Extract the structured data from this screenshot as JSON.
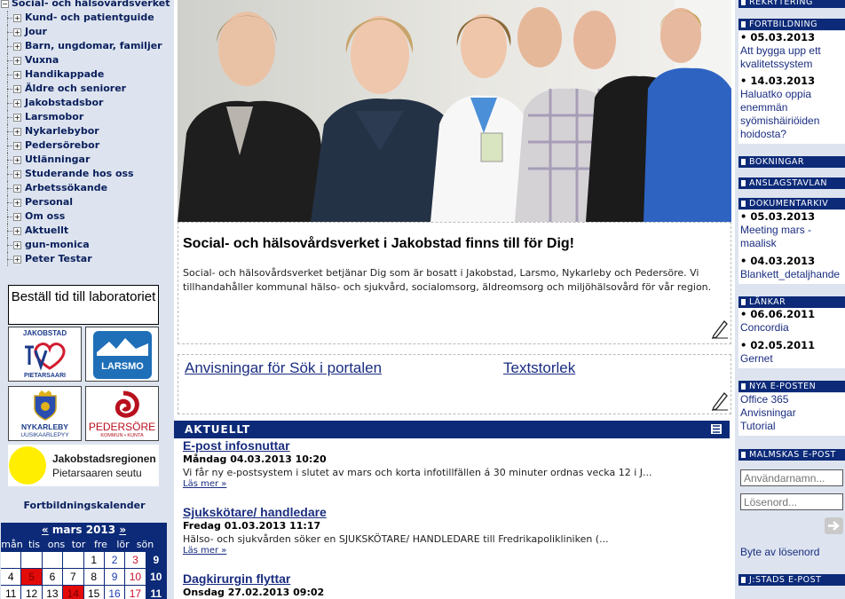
{
  "nav_tree": {
    "root": "Social- och hälsovårdsverket",
    "items": [
      "Kund- och patientguide",
      "Jour",
      "Barn, ungdomar, familjer",
      "Vuxna",
      "Handikappade",
      "Äldre och seniorer",
      "Jakobstadsbor",
      "Larsmobor",
      "Nykarlebybor",
      "Pedersörebor",
      "Utlänningar",
      "Studerande hos oss",
      "Arbetssökande",
      "Personal",
      "Om oss",
      "Aktuellt",
      "gun-monica",
      "Peter Testar"
    ]
  },
  "order_lab": "Beställ tid till laboratoriet",
  "logos": {
    "jakobstad": {
      "top": "JAKOBSTAD",
      "bottom": "PIETARSAARI"
    },
    "larsmo": "LARSMO",
    "nykarleby": {
      "top": "NYKARLEBY",
      "bottom": "UUSIKAARLEPYY"
    },
    "pedersore": {
      "top": "PEDERSÖRE",
      "bottom": "KOMMUN • KUNTA"
    },
    "region": {
      "line1": "Jakobstadsregionen",
      "line2": "Pietarsaaren seutu"
    }
  },
  "fortbildningskalender": "Fortbildningskalender",
  "calendar": {
    "prev": "«",
    "month": "mars 2013",
    "next": "»",
    "dow": [
      "mån",
      "tis",
      "ons",
      "tor",
      "fre",
      "lör",
      "sön"
    ],
    "rows": [
      [
        "",
        "",
        "",
        "",
        "1",
        "2",
        "3",
        "9"
      ],
      [
        "4",
        "5",
        "6",
        "7",
        "8",
        "9",
        "10",
        "10"
      ],
      [
        "11",
        "12",
        "13",
        "14",
        "15",
        "16",
        "17",
        "11"
      ]
    ]
  },
  "intro": {
    "title": "Social- och hälsovårdsverket i Jakobstad finns till för Dig!",
    "text": "Social- och hälsovårdsverket betjänar Dig som är bosatt i Jakobstad, Larsmo, Nykarleby och Pedersöre. Vi tillhandahåller kommunal hälso- och sjukvård, socialomsorg, äldreomsorg och miljöhälsovård för vår region."
  },
  "links": {
    "search_help": "Anvisningar för Sök i portalen",
    "text_size": "Textstorlek"
  },
  "news": {
    "header": "AKTUELLT",
    "items": [
      {
        "title": "E-post infosnuttar",
        "date": "Måndag 04.03.2013 10:20",
        "text": "Vi får ny e-postsystem i slutet av mars och korta infotillfällen á 30 minuter ordnas vecka 12 i J...",
        "more": "Läs mer »"
      },
      {
        "title": "Sjukskötare/ handledare",
        "date": "Fredag 01.03.2013 11:17",
        "text": "  Hälso- och sjukvården söker en SJUKSKÖTARE/ HANDLEDARE till Fredrikapolikliniken (...",
        "more": "Läs mer »"
      },
      {
        "title": "Dagkirurgin flyttar",
        "date": "Onsdag 27.02.2013 09:02"
      }
    ]
  },
  "right": {
    "rekrytering": "REKRYTERING",
    "fortbildning": {
      "header": "FORTBILDNING",
      "entries": [
        {
          "date": "• 05.03.2013",
          "lines": [
            "Att bygga upp ett",
            "kvalitetssystem"
          ]
        },
        {
          "date": "• 14.03.2013",
          "lines": [
            "Haluatko oppia",
            "enemmän",
            "syömishäiriöiden",
            "hoidosta?"
          ]
        }
      ]
    },
    "bokningar": "BOKNINGAR",
    "anslagstavlan": "ANSLAGSTAVLAN",
    "dokumentarkiv": {
      "header": "DOKUMENTARKIV",
      "entries": [
        {
          "date": "• 05.03.2013",
          "lines": [
            "Meeting mars -",
            "maalisk"
          ]
        },
        {
          "date": "• 04.03.2013",
          "lines": [
            "Blankett_detaljhande"
          ]
        }
      ]
    },
    "lankar": {
      "header": "LÄNKAR",
      "entries": [
        {
          "date": "• 06.06.2011",
          "lines": [
            "Concordia"
          ]
        },
        {
          "date": "• 02.05.2011",
          "lines": [
            "Gernet"
          ]
        }
      ]
    },
    "nya_eposten": {
      "header": "NYA E-POSTEN",
      "lines": [
        "Office 365",
        "Anvisningar",
        "Tutorial"
      ]
    },
    "malmskas": {
      "header": "MALMSKAS E-POST",
      "username_placeholder": "Användarnamn...",
      "password_placeholder": "Lösenord...",
      "forgot": "Byte av lösenord"
    },
    "jstads": "J:STADS E-POST"
  },
  "colors": {
    "navy": "#0c2a78",
    "sidebar_bg": "#dde4ef",
    "link": "#1a2d80",
    "holiday_red": "#e30a0a"
  }
}
